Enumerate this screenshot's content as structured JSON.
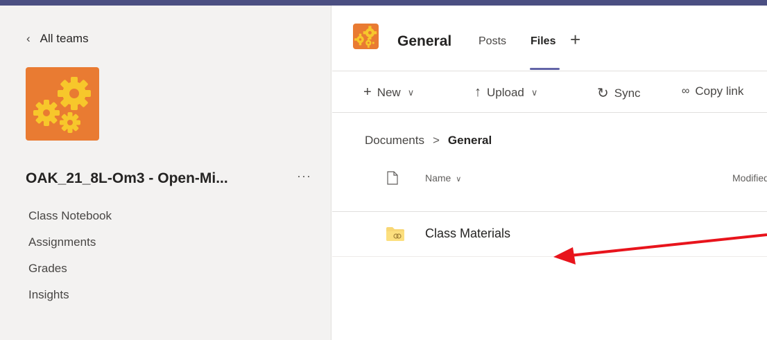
{
  "sidebar": {
    "back_label": "All teams",
    "team_name": "OAK_21_8L-Om3 - Open-Mi...",
    "more_label": "···",
    "nav": [
      "Class Notebook",
      "Assignments",
      "Grades",
      "Insights"
    ]
  },
  "channel": {
    "title": "General",
    "tabs": [
      {
        "label": "Posts",
        "active": false
      },
      {
        "label": "Files",
        "active": true
      }
    ],
    "add_tab_glyph": "+"
  },
  "toolbar": {
    "new_label": "New",
    "upload_label": "Upload",
    "sync_label": "Sync",
    "copy_link_label": "Copy link"
  },
  "breadcrumb": {
    "root": "Documents",
    "separator": ">",
    "current": "General"
  },
  "file_list": {
    "columns": {
      "name": "Name",
      "modified": "Modified"
    },
    "rows": [
      {
        "name": "Class Materials",
        "type": "folder"
      }
    ]
  },
  "colors": {
    "accent": "#6264a7",
    "topbar": "#4b4f82",
    "team_logo_bg": "#e97b32",
    "gear": "#f7c72b",
    "annotation_arrow": "#e8141c"
  },
  "icons": {
    "back": "chevron-left-icon",
    "new": "plus-icon",
    "upload": "upload-icon",
    "sync": "sync-icon",
    "copy_link": "link-icon",
    "doc": "document-icon",
    "folder": "folder-icon"
  }
}
